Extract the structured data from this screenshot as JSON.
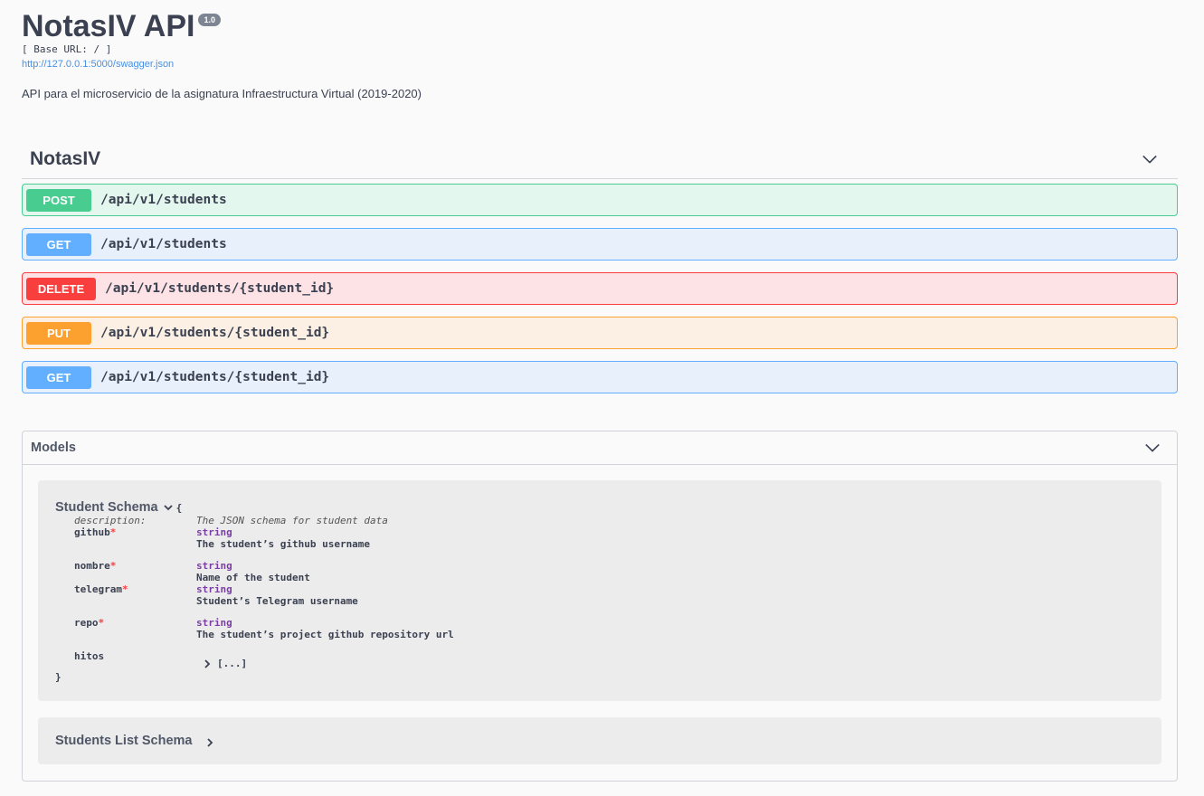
{
  "info": {
    "title": "NotasIV API",
    "version": "1.0",
    "base_url": "[ Base URL: / ]",
    "spec_url": "http://127.0.0.1:5000/swagger.json",
    "description": "API para el microservicio de la asignatura Infraestructura Virtual (2019-2020)"
  },
  "tag": {
    "name": "NotasIV",
    "operations": [
      {
        "method": "POST",
        "path": "/api/v1/students"
      },
      {
        "method": "GET",
        "path": "/api/v1/students"
      },
      {
        "method": "DELETE",
        "path": "/api/v1/students/{student_id}"
      },
      {
        "method": "PUT",
        "path": "/api/v1/students/{student_id}"
      },
      {
        "method": "GET",
        "path": "/api/v1/students/{student_id}"
      }
    ]
  },
  "models": {
    "title": "Models",
    "student_schema": {
      "name": "Student Schema",
      "open_brace": "{",
      "close_brace": "}",
      "description_key": "description:",
      "description_value": "The JSON schema for student data",
      "properties": [
        {
          "key": "github",
          "type": "string",
          "desc": "The student’s github username"
        },
        {
          "key": "nombre",
          "type": "string",
          "desc": "Name of the student"
        },
        {
          "key": "telegram",
          "type": "string",
          "desc": "Student’s Telegram username"
        },
        {
          "key": "repo",
          "type": "string",
          "desc": "The student’s project github repository url"
        }
      ],
      "required_mark": "*",
      "hitos": {
        "key": "hitos",
        "collapsed": "[...]"
      }
    },
    "students_list_schema": {
      "name": "Students List Schema"
    }
  },
  "icons": {
    "expand": "chevron-down-icon",
    "collapsed": "chevron-right-icon"
  }
}
